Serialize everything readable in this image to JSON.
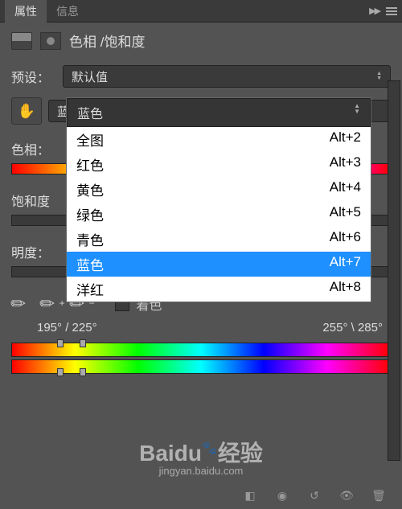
{
  "tabs": {
    "properties": "属性",
    "info": "信息"
  },
  "header": {
    "title": "色相 /饱和度"
  },
  "preset": {
    "label": "预设：",
    "value": "默认值"
  },
  "channel": {
    "selected": "蓝色"
  },
  "dropdown": {
    "items": [
      {
        "label": "全图",
        "shortcut": "Alt+2"
      },
      {
        "label": "红色",
        "shortcut": "Alt+3"
      },
      {
        "label": "黄色",
        "shortcut": "Alt+4"
      },
      {
        "label": "绿色",
        "shortcut": "Alt+5"
      },
      {
        "label": "青色",
        "shortcut": "Alt+6"
      },
      {
        "label": "蓝色",
        "shortcut": "Alt+7"
      },
      {
        "label": "洋红",
        "shortcut": "Alt+8"
      }
    ]
  },
  "sliders": {
    "hue": "色相：",
    "saturation": "饱和度",
    "lightness": "明度："
  },
  "colorize": {
    "label": "着色"
  },
  "degrees": {
    "left1": "195°",
    "left2": "225°",
    "right1": "255°",
    "right2": "285°"
  },
  "watermark": {
    "brand": "Baidu",
    "suffix": "经验",
    "url": "jingyan.baidu.com"
  }
}
